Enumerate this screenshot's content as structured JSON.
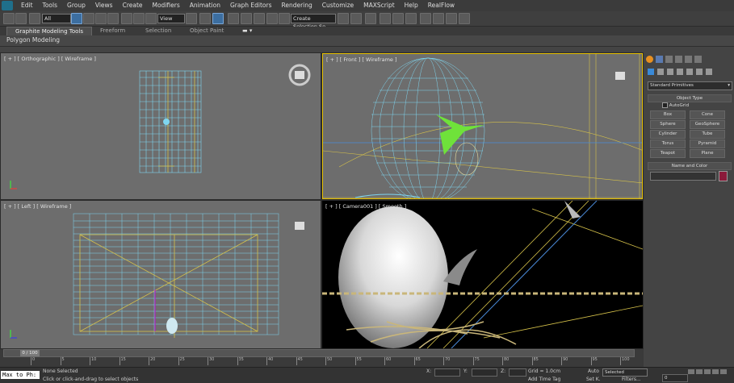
{
  "menu": [
    "Edit",
    "Tools",
    "Group",
    "Views",
    "Create",
    "Modifiers",
    "Animation",
    "Graph Editors",
    "Rendering",
    "Customize",
    "MAXScript",
    "Help",
    "RealFlow"
  ],
  "toolbar": {
    "filter_value": "All",
    "reference_coord": "View",
    "named_selection": "Create Selection Se"
  },
  "ribbon": {
    "tabs": [
      "Graphite Modeling Tools",
      "Freeform",
      "Selection",
      "Object Paint"
    ],
    "panel_label": "Polygon Modeling"
  },
  "viewports": {
    "top_left": "[ + ] [ Orthographic ] [ Wireframe ]",
    "top_right": "[ + ] [ Front ] [ Wireframe ]",
    "bottom_left": "[ + ] [ Left ] [ Wireframe ]",
    "bottom_right": "[ + ] [ Camera001 ] [ Smooth ]"
  },
  "command_panel": {
    "dropdown": "Standard Primitives",
    "object_type_header": "Object Type",
    "autogrid": "AutoGrid",
    "buttons": [
      "Box",
      "Cone",
      "Sphere",
      "GeoSphere",
      "Cylinder",
      "Tube",
      "Torus",
      "Pyramid",
      "Teapot",
      "Plane"
    ],
    "name_color_header": "Name and Color",
    "color": "#8b1a3a"
  },
  "timeline": {
    "frame_display": "0 / 100",
    "ticks": [
      "0",
      "5",
      "10",
      "15",
      "20",
      "25",
      "30",
      "35",
      "40",
      "45",
      "50",
      "55",
      "60",
      "65",
      "70",
      "75",
      "80",
      "85",
      "90",
      "95",
      "100"
    ]
  },
  "status": {
    "maxscript": "Max to Ph:",
    "selection": "None Selected",
    "prompt": "Click or click-and-drag to select objects",
    "x_label": "X:",
    "y_label": "Y:",
    "z_label": "Z:",
    "grid": "Grid = 1.0cm",
    "add_time_tag": "Add Time Tag",
    "auto_label": "Auto",
    "set_key_label": "Set K.",
    "selected_value": "Selected",
    "filters": "Filters...",
    "frame": "0"
  },
  "colors": {
    "wire_cyan": "#7fd6f0",
    "wire_yellow": "#d6c24a",
    "green_object": "#6fe23a",
    "viewport_bg": "#6d6d6d",
    "camera_bg": "#000000"
  }
}
